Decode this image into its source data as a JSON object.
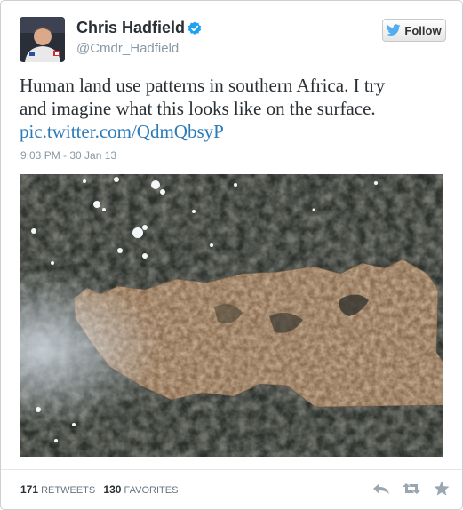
{
  "user": {
    "name": "Chris Hadfield",
    "handle": "@Cmdr_Hadfield",
    "avatar_icon": "astronaut-avatar",
    "verified_icon": "verified-badge-icon"
  },
  "follow_button": {
    "label": "Follow",
    "icon": "twitter-bird-icon"
  },
  "tweet": {
    "line1": "Human land use patterns in southern Africa. I try",
    "line2": "and imagine what this looks like on the surface.",
    "link": "pic.twitter.com/QdmQbsyP",
    "timestamp": "9:03 PM - 30 Jan 13"
  },
  "stats": {
    "retweets_count": "171",
    "retweets_label": "RETWEETS",
    "favorites_count": "130",
    "favorites_label": "FAVORITES"
  },
  "actions": {
    "reply_icon": "reply-icon",
    "retweet_icon": "retweet-icon",
    "favorite_icon": "star-icon"
  },
  "colors": {
    "link": "#2b7bb9",
    "verified": "#1da1f2",
    "text": "#292f33",
    "muted": "#8899a6"
  }
}
